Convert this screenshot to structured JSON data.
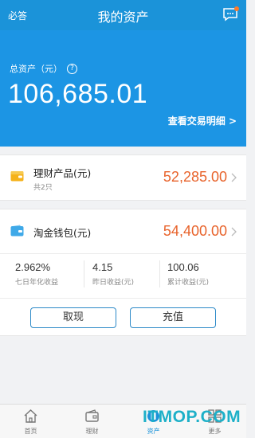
{
  "header": {
    "left_label": "必答",
    "title": "我的资产",
    "message_icon": "message-icon"
  },
  "assets": {
    "label": "总资产（元）",
    "help_symbol": "?",
    "total": "106,685.01",
    "detail_link": "查看交易明细 >"
  },
  "products": {
    "icon": "wallet-card-icon",
    "name": "理财产品(元)",
    "sub": "共2只",
    "amount": "52,285.00"
  },
  "wallet": {
    "icon": "blue-wallet-icon",
    "name": "淘金钱包(元)",
    "amount": "54,400.00",
    "stats": [
      {
        "value": "2.962%",
        "label": "七日年化收益"
      },
      {
        "value": "4.15",
        "label": "昨日收益(元)"
      },
      {
        "value": "100.06",
        "label": "累计收益(元)"
      }
    ],
    "withdraw_label": "取现",
    "recharge_label": "充值"
  },
  "tabs": [
    {
      "label": "首页",
      "icon": "home-icon",
      "active": false
    },
    {
      "label": "理财",
      "icon": "finance-icon",
      "active": false
    },
    {
      "label": "资产",
      "icon": "assets-icon",
      "active": true
    },
    {
      "label": "更多",
      "icon": "more-icon",
      "active": false
    }
  ],
  "watermark": "ITMOP.COM",
  "colors": {
    "brand_blue": "#1c95e4",
    "amount_orange": "#e8632b",
    "header_dark": "#1b93d9"
  }
}
